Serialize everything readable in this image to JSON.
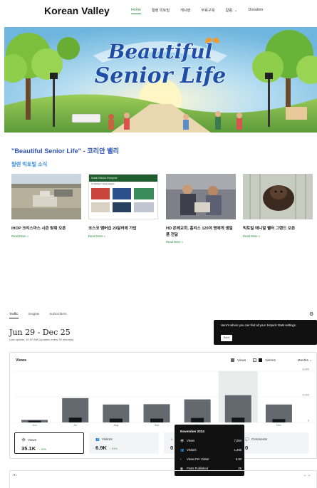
{
  "site": {
    "brand": "Korean Valley",
    "nav": [
      "Home",
      "릴렌 빅토빌",
      "게시판",
      "무료구독",
      "칼럼",
      "Donation"
    ],
    "nav_active": 0,
    "column_chevron": "⌄"
  },
  "hero": {
    "line1": "Beautiful",
    "line2": "Senior Life"
  },
  "post": {
    "title": "\"Beautiful Senior Life\" - 코리안 밸리",
    "section": "릴렌 빅토빌 소식"
  },
  "cards": [
    {
      "title": "IHOP 크리스마스 시즌 맞춰 오픈",
      "more": "Read More »"
    },
    {
      "title": "코스코 멤버십 20달러에 가입",
      "more": "Read More »",
      "thumb_header": "Great Gifts for Everyone",
      "thumb_sub": "Up Selling In Vidwal Heights"
    },
    {
      "title": "HD 온헤교회, 홈리스 120여 명에게 생필품 전달",
      "more": "Read More »"
    },
    {
      "title": "빅토빌 애니멀 웰터 그랜드 오픈",
      "more": "Read More »"
    }
  ],
  "stats": {
    "tabs": [
      "Traffic",
      "Insights",
      "Subscribers"
    ],
    "active_tab": 0,
    "gear_icon": "⚙",
    "date_range": "Jun 29 - Dec 25",
    "last_update": "Last update: 10:37 AM (Updates every 30 minutes)",
    "tooltip": {
      "text": "Here's where you can find all your Jetpack Stats settings.",
      "button": "Got it"
    },
    "panel_title": "Views",
    "legend": [
      {
        "label": "Views",
        "color": "#646970"
      },
      {
        "label": "Visitors",
        "color": "#101517"
      }
    ],
    "visitors_check": "✓",
    "period": "Months ⌄"
  },
  "chart_data": {
    "type": "bar",
    "categories": [
      "Jun",
      "Jul",
      "Aug",
      "Sep",
      "Oct",
      "Nov",
      "Dec"
    ],
    "series": [
      {
        "name": "Views",
        "values": [
          400,
          3800,
          2800,
          2850,
          3600,
          4250,
          2800
        ]
      },
      {
        "name": "Visitors",
        "values": [
          280,
          750,
          600,
          600,
          700,
          750,
          520
        ]
      }
    ],
    "yticks": [
      "0",
      "4,000",
      "8,000"
    ],
    "ylim": [
      0,
      8000
    ],
    "highlight_category": "Nov",
    "colors": {
      "views": "#646970",
      "visitors": "#101517",
      "highlight": "#e8ecea"
    }
  },
  "summary": [
    {
      "icon": "👁",
      "label": "Views",
      "value": "35.1K",
      "delta": "↑ 15%"
    },
    {
      "icon": "👥",
      "label": "Visitors",
      "value": "6.9K",
      "delta": "↑ 31%"
    },
    {
      "icon": "☆",
      "label": "",
      "value": "0",
      "delta": ""
    },
    {
      "icon": "💬",
      "label": "Comments",
      "value": "0",
      "delta": ""
    }
  ],
  "popup": {
    "header": "November 2024",
    "rows": [
      {
        "icon": "👁",
        "label": "Views",
        "value": "7,004"
      },
      {
        "icon": "👥",
        "label": "Visitors",
        "value": "1,265"
      },
      {
        "icon": "›",
        "label": "Views Per Visitor",
        "value": "5.60"
      },
      {
        "icon": "▦",
        "label": "Posts Published",
        "value": "25"
      }
    ]
  },
  "bottom_bar": {
    "left": "▾ •",
    "right": "← →"
  }
}
